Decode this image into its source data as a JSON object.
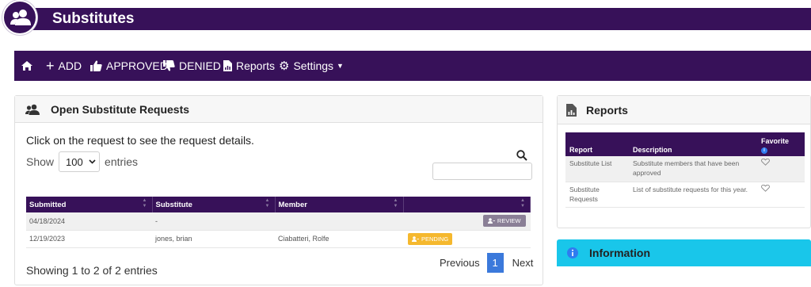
{
  "app": {
    "title": "Substitutes"
  },
  "nav": {
    "add": "ADD",
    "approved": "APPROVED",
    "denied": "DENIED",
    "reports": "Reports",
    "settings": "Settings"
  },
  "open_requests": {
    "title": "Open Substitute Requests",
    "instructions": "Click on the request to see the request details.",
    "show_prefix": "Show",
    "show_value": "100",
    "show_suffix": "entries",
    "search_value": "",
    "columns": [
      "Submitted",
      "Substitute",
      "Member",
      ""
    ],
    "rows": [
      {
        "submitted": "04/18/2024",
        "substitute": "-",
        "member": "",
        "action": "REVIEW"
      },
      {
        "submitted": "12/19/2023",
        "substitute": "jones, brian",
        "member": "Ciabatteri, Rolfe",
        "action": "PENDING"
      }
    ],
    "showing": "Showing 1 to 2 of 2 entries",
    "pager": {
      "previous": "Previous",
      "page": "1",
      "next": "Next"
    }
  },
  "reports": {
    "title": "Reports",
    "columns": {
      "report": "Report",
      "description": "Description",
      "favorite": "Favorite"
    },
    "rows": [
      {
        "report": "Substitute List",
        "description": "Substitute members that have been approved"
      },
      {
        "report": "Substitute Requests",
        "description": "List of substitute requests for this year."
      }
    ]
  },
  "information": {
    "title": "Information"
  },
  "colors": {
    "brand": "#371159",
    "info": "#19c6ea",
    "pending": "#f5b82e",
    "review": "#8a7f96",
    "active_page": "#3b79db"
  },
  "icons": [
    "users-icon",
    "home-icon",
    "plus-icon",
    "thumbs-up-icon",
    "thumbs-down-icon",
    "report-icon",
    "gear-icon",
    "caret-down-icon",
    "search-icon",
    "heart-icon",
    "info-icon"
  ]
}
